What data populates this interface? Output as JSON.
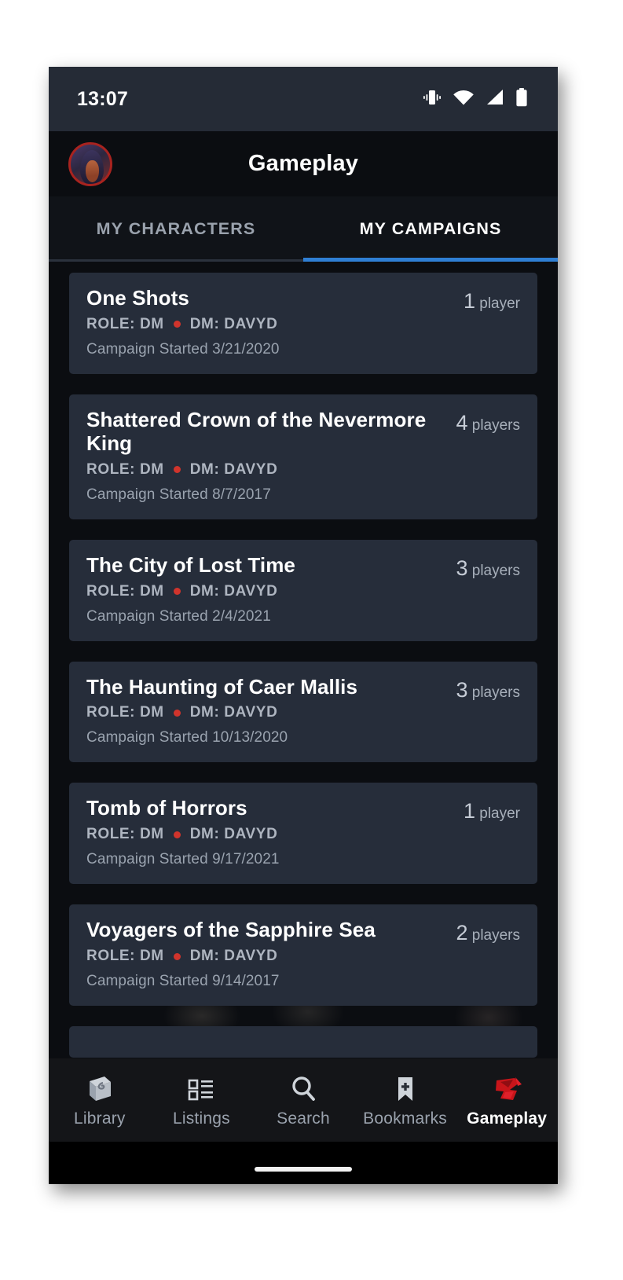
{
  "status_bar": {
    "time": "13:07",
    "icons": [
      "vibrate-icon",
      "wifi-icon",
      "cellular-signal-icon",
      "battery-icon"
    ]
  },
  "app_bar": {
    "title": "Gameplay",
    "avatar": "user-avatar"
  },
  "tabs": {
    "items": [
      {
        "label": "MY CHARACTERS",
        "active": false
      },
      {
        "label": "MY CAMPAIGNS",
        "active": true
      }
    ],
    "indicator_color": "#2f7fd4"
  },
  "campaigns": [
    {
      "title": "One Shots",
      "role": "ROLE: DM",
      "dm": "DM: DAVYD",
      "started": "Campaign Started 3/21/2020",
      "player_count": "1",
      "player_label": "player"
    },
    {
      "title": "Shattered Crown of the Nevermore King",
      "role": "ROLE: DM",
      "dm": "DM: DAVYD",
      "started": "Campaign Started 8/7/2017",
      "player_count": "4",
      "player_label": "players"
    },
    {
      "title": "The City of Lost Time",
      "role": "ROLE: DM",
      "dm": "DM: DAVYD",
      "started": "Campaign Started 2/4/2021",
      "player_count": "3",
      "player_label": "players"
    },
    {
      "title": "The Haunting of Caer Mallis",
      "role": "ROLE: DM",
      "dm": "DM: DAVYD",
      "started": "Campaign Started 10/13/2020",
      "player_count": "3",
      "player_label": "players"
    },
    {
      "title": "Tomb of Horrors",
      "role": "ROLE: DM",
      "dm": "DM: DAVYD",
      "started": "Campaign Started 9/17/2021",
      "player_count": "1",
      "player_label": "player"
    },
    {
      "title": "Voyagers of the Sapphire Sea",
      "role": "ROLE: DM",
      "dm": "DM: DAVYD",
      "started": "Campaign Started 9/14/2017",
      "player_count": "2",
      "player_label": "players"
    }
  ],
  "bottom_nav": {
    "items": [
      {
        "label": "Library",
        "icon": "book-icon",
        "active": false
      },
      {
        "label": "Listings",
        "icon": "list-icon",
        "active": false
      },
      {
        "label": "Search",
        "icon": "search-icon",
        "active": false
      },
      {
        "label": "Bookmarks",
        "icon": "bookmark-icon",
        "active": false
      },
      {
        "label": "Gameplay",
        "icon": "dnd-logo-icon",
        "active": true
      }
    ]
  },
  "colors": {
    "accent": "#2f7fd4",
    "card": "#262d3a",
    "page": "#0b0d11",
    "status_bar": "#252b36",
    "dot": "#d0342c",
    "brand_red": "#c8151a"
  }
}
